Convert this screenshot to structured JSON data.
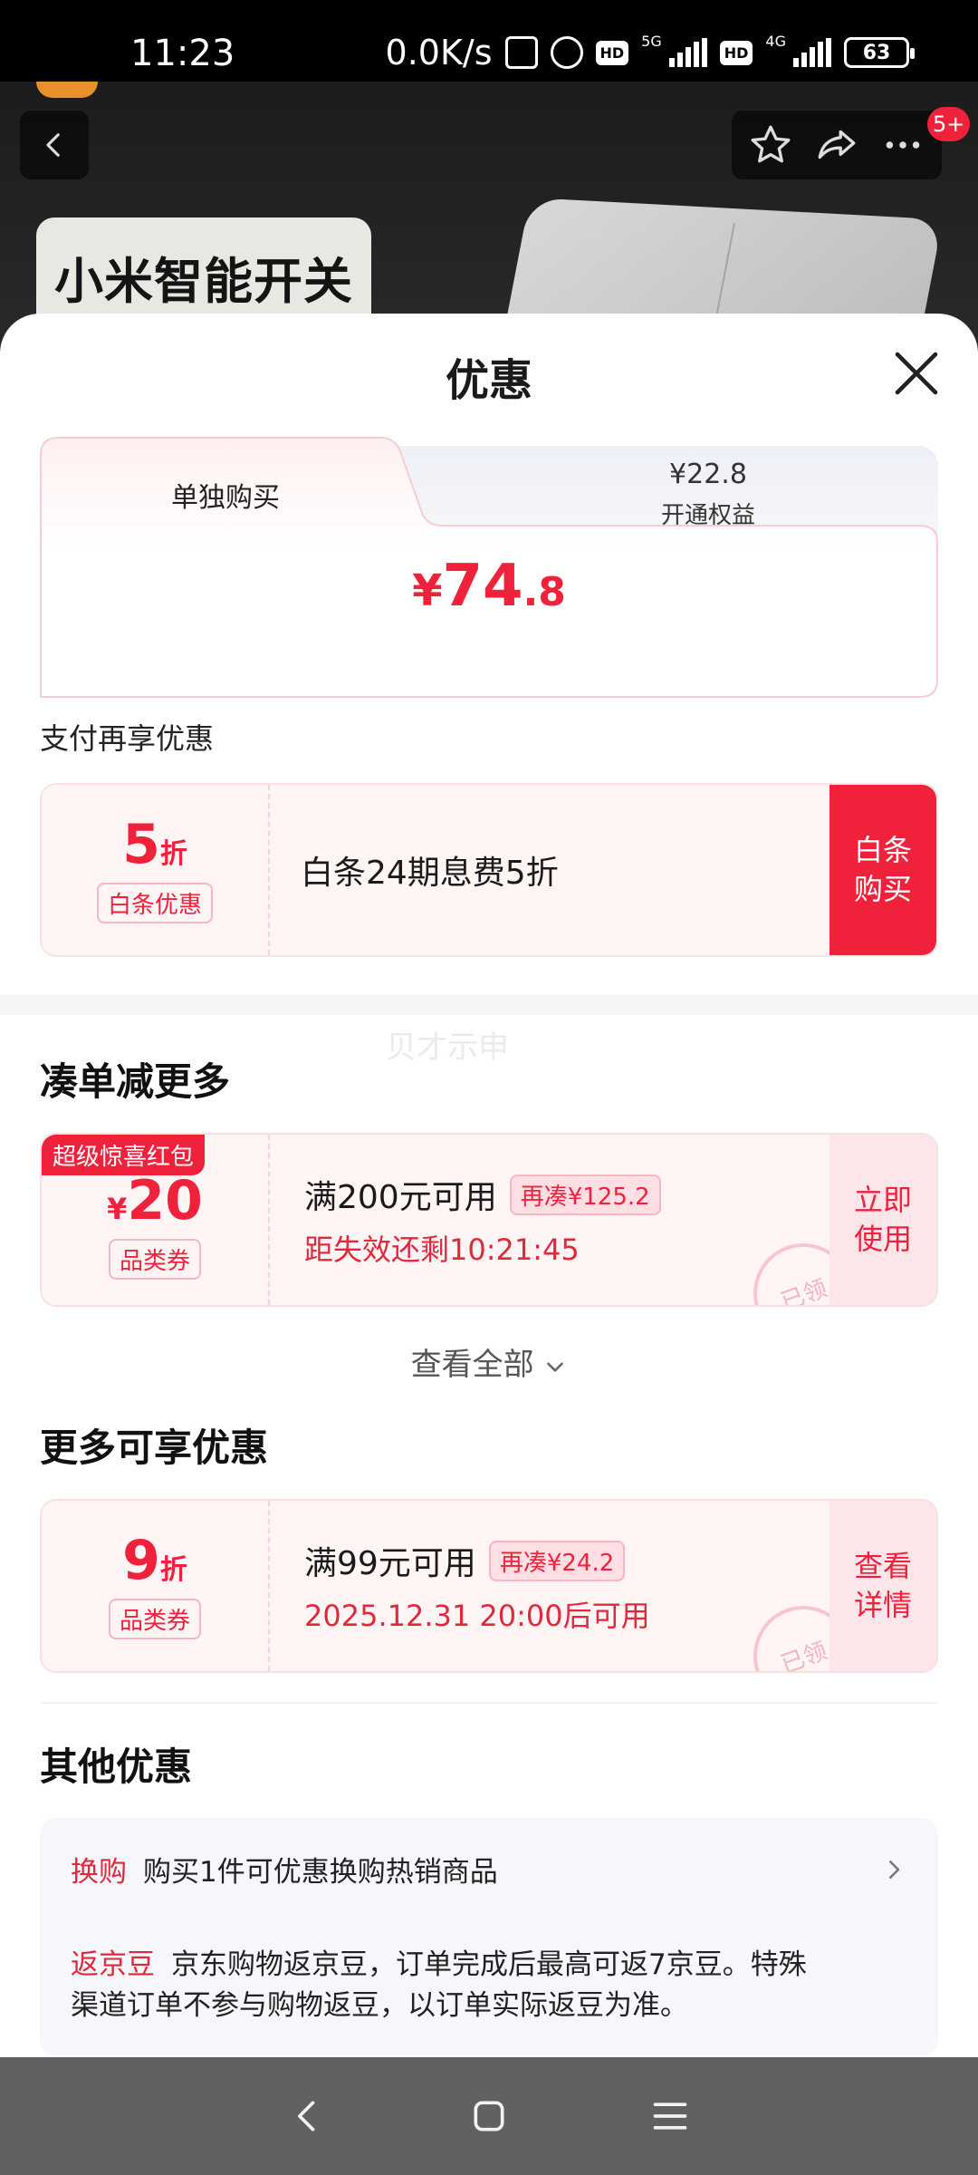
{
  "status_bar": {
    "time": "11:23",
    "network_speed": "0.0K/s",
    "signal_1": "5G",
    "signal_2": "4G",
    "battery": "63"
  },
  "product": {
    "banner_title": "小米智能开关",
    "cart_badge": "5+"
  },
  "sheet": {
    "title": "优惠",
    "tabs": {
      "active_label": "单独购买",
      "inactive_price": "¥22.8",
      "inactive_label": "开通权益"
    },
    "price": {
      "currency": "¥",
      "integer": "74",
      "decimal": ".8"
    },
    "pay_section_label": "支付再享优惠",
    "baitiao_card": {
      "discount_num": "5",
      "discount_unit": "折",
      "tag": "白条优惠",
      "description": "白条24期息费5折",
      "action": "白条\n购买"
    },
    "watermark": "贝才示申",
    "section_combine": "凑单减更多",
    "combine_card": {
      "corner_label": "超级惊喜红包",
      "currency": "¥",
      "amount": "20",
      "tag": "品类券",
      "condition": "满200元可用",
      "pill": "再凑¥125.2",
      "countdown": "距失效还剩10:21:45",
      "action": "立即\n使用",
      "stamp": "已领"
    },
    "view_all": "查看全部",
    "section_more": "更多可享优惠",
    "more_card": {
      "discount_num": "9",
      "discount_unit": "折",
      "tag": "品类券",
      "condition": "满99元可用",
      "pill": "再凑¥24.2",
      "available_time": "2025.12.31 20:00后可用",
      "action": "查看\n详情",
      "stamp": "已领"
    },
    "section_other": "其他优惠",
    "other": {
      "exchange_keyword": "换购",
      "exchange_text": "购买1件可优惠换购热销商品",
      "bean_keyword": "返京豆",
      "bean_text": "京东购物返京豆，订单完成后最高可返7京豆。特殊",
      "bean_text_2": "渠道订单不参与购物返豆，以订单实际返豆为准。"
    }
  },
  "colors": {
    "accent": "#f0213b",
    "card_bg": "#fff5f5",
    "nav_bg": "#616161"
  }
}
